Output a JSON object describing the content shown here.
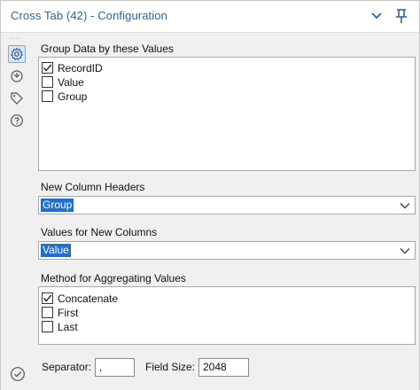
{
  "window": {
    "title": "Cross Tab (42) - Configuration"
  },
  "titlebar": {
    "collapse_icon": "chevron-down-icon",
    "pin_icon": "pin-icon"
  },
  "sidebar": {
    "more": "...",
    "items": [
      {
        "icon": "gear-icon",
        "active": true
      },
      {
        "icon": "connections-icon",
        "active": false
      },
      {
        "icon": "tag-icon",
        "active": false
      },
      {
        "icon": "help-icon",
        "active": false
      }
    ]
  },
  "group_section": {
    "label": "Group Data by these Values",
    "items": [
      {
        "label": "RecordID",
        "checked": true
      },
      {
        "label": "Value",
        "checked": false
      },
      {
        "label": "Group",
        "checked": false
      }
    ]
  },
  "headers_section": {
    "label": "New Column Headers",
    "selected": "Group"
  },
  "values_section": {
    "label": "Values for New Columns",
    "selected": "Value"
  },
  "method_section": {
    "label": "Method for Aggregating Values",
    "items": [
      {
        "label": "Concatenate",
        "checked": true
      },
      {
        "label": "First",
        "checked": false
      },
      {
        "label": "Last",
        "checked": false
      }
    ]
  },
  "bottom": {
    "separator_label": "Separator:",
    "separator_value": ",",
    "field_size_label": "Field Size:",
    "field_size_value": "2048"
  },
  "colors": {
    "title_blue": "#2565a8",
    "selection_blue": "#1f6fd1",
    "panel_bg": "#f0f0f0"
  }
}
